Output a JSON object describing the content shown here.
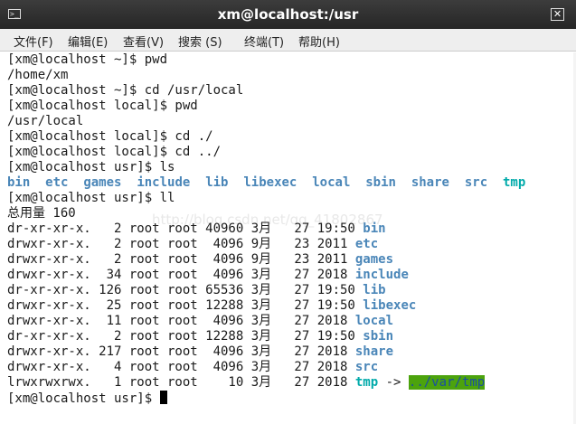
{
  "window": {
    "title": "xm@localhost:/usr",
    "icon": "terminal-icon",
    "close_glyph": "✕"
  },
  "menu": [
    {
      "label": "文件(F)"
    },
    {
      "label": "编辑(E)"
    },
    {
      "label": "查看(V)"
    },
    {
      "label": "搜索 (S)"
    },
    {
      "label": "终端(T)"
    },
    {
      "label": "帮助(H)"
    }
  ],
  "terminal": {
    "colors": {
      "background": "#ffffff",
      "text": "#1a1a1a",
      "directory": "#4a86b8",
      "symlink": "#00aaaa",
      "sticky_other_writable_bg": "#4ca30d"
    },
    "history": [
      "[xm@localhost ~]$ pwd",
      "/home/xm",
      "[xm@localhost ~]$ cd /usr/local",
      "[xm@localhost local]$ pwd",
      "/usr/local",
      "[xm@localhost local]$ cd ./",
      "[xm@localhost local]$ cd ../",
      "[xm@localhost usr]$ ls"
    ],
    "ls_output": [
      "bin",
      "etc",
      "games",
      "include",
      "lib",
      "libexec",
      "local",
      "sbin",
      "share",
      "src",
      "tmp"
    ],
    "ll_prompt": "[xm@localhost usr]$ ll",
    "total_line": "总用量 160",
    "ll_rows": [
      {
        "info": "dr-xr-xr-x.   2 root root 40960 3月   27 19:50 ",
        "name": "bin",
        "kind": "dir"
      },
      {
        "info": "drwxr-xr-x.   2 root root  4096 9月   23 2011 ",
        "name": "etc",
        "kind": "dir"
      },
      {
        "info": "drwxr-xr-x.   2 root root  4096 9月   23 2011 ",
        "name": "games",
        "kind": "dir"
      },
      {
        "info": "drwxr-xr-x.  34 root root  4096 3月   27 2018 ",
        "name": "include",
        "kind": "dir"
      },
      {
        "info": "dr-xr-xr-x. 126 root root 65536 3月   27 19:50 ",
        "name": "lib",
        "kind": "dir"
      },
      {
        "info": "drwxr-xr-x.  25 root root 12288 3月   27 19:50 ",
        "name": "libexec",
        "kind": "dir"
      },
      {
        "info": "drwxr-xr-x.  11 root root  4096 3月   27 2018 ",
        "name": "local",
        "kind": "dir"
      },
      {
        "info": "dr-xr-xr-x.   2 root root 12288 3月   27 19:50 ",
        "name": "sbin",
        "kind": "dir"
      },
      {
        "info": "drwxr-xr-x. 217 root root  4096 3月   27 2018 ",
        "name": "share",
        "kind": "dir"
      },
      {
        "info": "drwxr-xr-x.   4 root root  4096 3月   27 2018 ",
        "name": "src",
        "kind": "dir"
      },
      {
        "info": "lrwxrwxrwx.   1 root root    10 3月   27 2018 ",
        "name": "tmp",
        "kind": "link",
        "arrow": " -> ",
        "target": "../var/tmp"
      }
    ],
    "final_prompt": "[xm@localhost usr]$ ",
    "watermark": "http://blog.csdn.net/qq_41802867"
  }
}
